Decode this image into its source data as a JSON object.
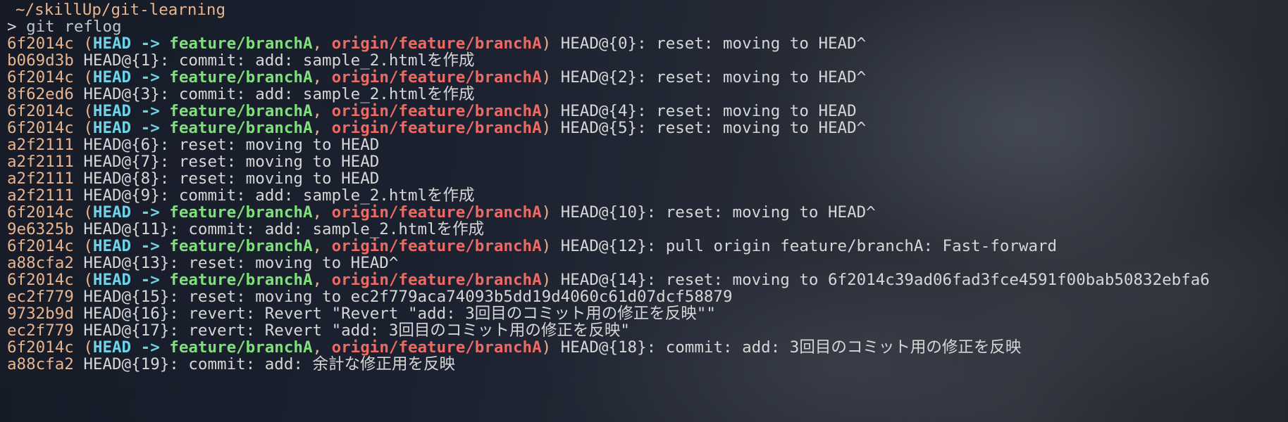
{
  "terminal": {
    "cwd": "~/skillUp/git-learning",
    "prompt_symbol": ">",
    "command": "git reflog",
    "decoration": {
      "open_paren": "(",
      "close_paren": ")",
      "head": "HEAD ->",
      "local_branch": "feature/branchA",
      "comma": ",",
      "remote_branch": "origin/feature/branchA"
    },
    "entries": [
      {
        "hash": "6f2014c",
        "decorated": true,
        "message": "HEAD@{0}: reset: moving to HEAD^"
      },
      {
        "hash": "b069d3b",
        "decorated": false,
        "message": "HEAD@{1}: commit: add: sample_2.htmlを作成"
      },
      {
        "hash": "6f2014c",
        "decorated": true,
        "message": "HEAD@{2}: reset: moving to HEAD^"
      },
      {
        "hash": "8f62ed6",
        "decorated": false,
        "message": "HEAD@{3}: commit: add: sample_2.htmlを作成"
      },
      {
        "hash": "6f2014c",
        "decorated": true,
        "message": "HEAD@{4}: reset: moving to HEAD"
      },
      {
        "hash": "6f2014c",
        "decorated": true,
        "message": "HEAD@{5}: reset: moving to HEAD^"
      },
      {
        "hash": "a2f2111",
        "decorated": false,
        "message": "HEAD@{6}: reset: moving to HEAD"
      },
      {
        "hash": "a2f2111",
        "decorated": false,
        "message": "HEAD@{7}: reset: moving to HEAD"
      },
      {
        "hash": "a2f2111",
        "decorated": false,
        "message": "HEAD@{8}: reset: moving to HEAD"
      },
      {
        "hash": "a2f2111",
        "decorated": false,
        "message": "HEAD@{9}: commit: add: sample_2.htmlを作成"
      },
      {
        "hash": "6f2014c",
        "decorated": true,
        "message": "HEAD@{10}: reset: moving to HEAD^"
      },
      {
        "hash": "9e6325b",
        "decorated": false,
        "message": "HEAD@{11}: commit: add: sample_2.htmlを作成"
      },
      {
        "hash": "6f2014c",
        "decorated": true,
        "message": "HEAD@{12}: pull origin feature/branchA: Fast-forward"
      },
      {
        "hash": "a88cfa2",
        "decorated": false,
        "message": "HEAD@{13}: reset: moving to HEAD^"
      },
      {
        "hash": "6f2014c",
        "decorated": true,
        "message": "HEAD@{14}: reset: moving to 6f2014c39ad06fad3fce4591f00bab50832ebfa6"
      },
      {
        "hash": "ec2f779",
        "decorated": false,
        "message": "HEAD@{15}: reset: moving to ec2f779aca74093b5dd19d4060c61d07dcf58879"
      },
      {
        "hash": "9732b9d",
        "decorated": false,
        "message": "HEAD@{16}: revert: Revert \"Revert \"add: 3回目のコミット用の修正を反映\"\""
      },
      {
        "hash": "ec2f779",
        "decorated": false,
        "message": "HEAD@{17}: revert: Revert \"add: 3回目のコミット用の修正を反映\""
      },
      {
        "hash": "6f2014c",
        "decorated": true,
        "message": "HEAD@{18}: commit: add: 3回目のコミット用の修正を反映"
      },
      {
        "hash": "a88cfa2",
        "decorated": false,
        "message": "HEAD@{19}: commit: add: 余計な修正用を反映"
      }
    ]
  },
  "colors": {
    "hash": "#e8b48c",
    "head": "#6fd3e8",
    "local_branch": "#7ee07a",
    "remote_branch": "#ec6a63",
    "text": "#d6d6d6"
  }
}
